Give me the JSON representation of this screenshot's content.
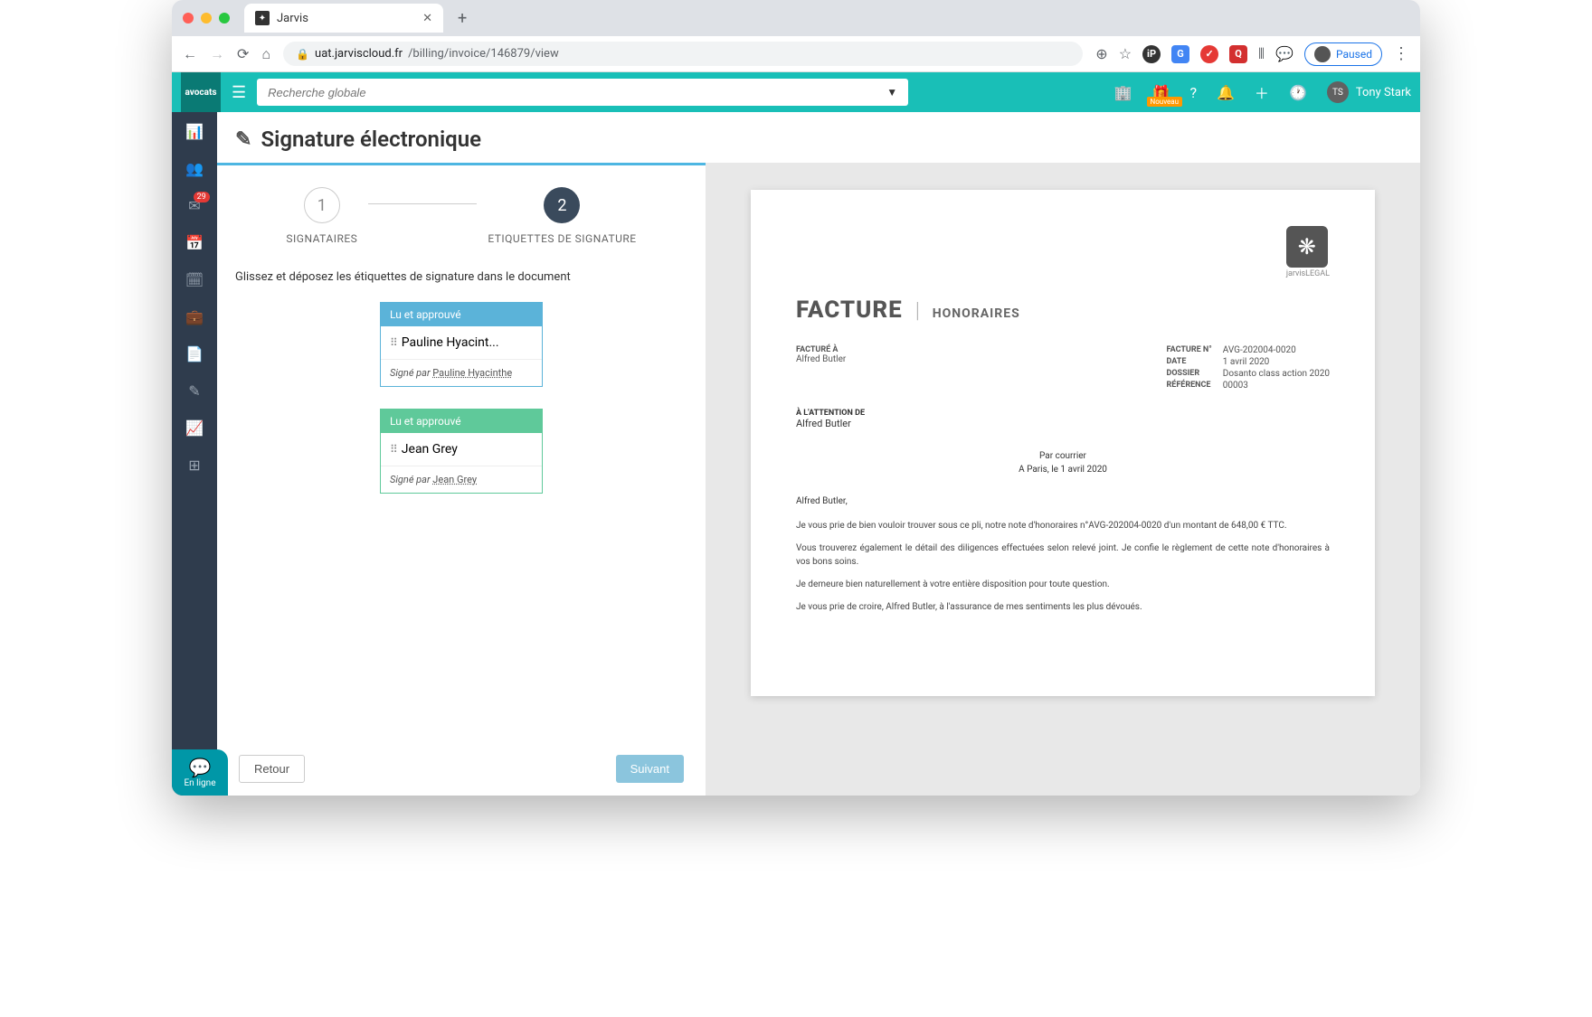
{
  "browser": {
    "tab_title": "Jarvis",
    "url_host": "uat.jarviscloud.fr",
    "url_path": "/billing/invoice/146879/view",
    "paused_label": "Paused"
  },
  "appbar": {
    "logo_text": "avocats",
    "search_placeholder": "Recherche globale",
    "nouveau_badge": "Nouveau",
    "user_initials": "TS",
    "user_name": "Tony Stark"
  },
  "sidenav": {
    "mail_badge": "29",
    "chat_label": "En ligne"
  },
  "page": {
    "title": "Signature électronique",
    "step1_label": "SIGNATAIRES",
    "step2_label": "ETIQUETTES DE SIGNATURE",
    "step1_num": "1",
    "step2_num": "2",
    "instruction": "Glissez et déposez les étiquettes de signature dans le document",
    "back_btn": "Retour",
    "next_btn": "Suivant"
  },
  "signers": [
    {
      "approved_label": "Lu et approuvé",
      "name": "Pauline Hyacint...",
      "signed_by_prefix": "Signé par",
      "signed_name": "Pauline Hyacinthe"
    },
    {
      "approved_label": "Lu et approuvé",
      "name": "Jean Grey",
      "signed_by_prefix": "Signé par",
      "signed_name": "Jean Grey"
    }
  ],
  "doc": {
    "brand": "jarvisLEGAL",
    "title": "FACTURE",
    "subtitle": "HONORAIRES",
    "billed_to_label": "FACTURÉ À",
    "billed_to_name": "Alfred Butler",
    "meta": {
      "num_label": "FACTURE N°",
      "num_val": "AVG-202004-0020",
      "date_label": "DATE",
      "date_val": "1 avril 2020",
      "dossier_label": "DOSSIER",
      "dossier_val": "Dosanto class action 2020",
      "ref_label": "RÉFÉRENCE",
      "ref_val": "00003"
    },
    "attn_label": "À L'ATTENTION DE",
    "attn_name": "Alfred Butler",
    "courier": "Par courrier",
    "dateline": "A Paris, le 1 avril 2020",
    "salutation": "Alfred Butler,",
    "p1": "Je vous prie de bien vouloir trouver sous ce pli, notre note d'honoraires n°AVG-202004-0020 d'un montant de 648,00 € TTC.",
    "p2": "Vous trouverez également le détail des diligences effectuées selon relevé joint. Je confie le règlement de cette note d'honoraires à vos bons soins.",
    "p3": "Je demeure bien naturellement à votre entière disposition pour toute question.",
    "p4": "Je vous prie de croire, Alfred Butler, à l'assurance de mes sentiments les plus dévoués."
  }
}
